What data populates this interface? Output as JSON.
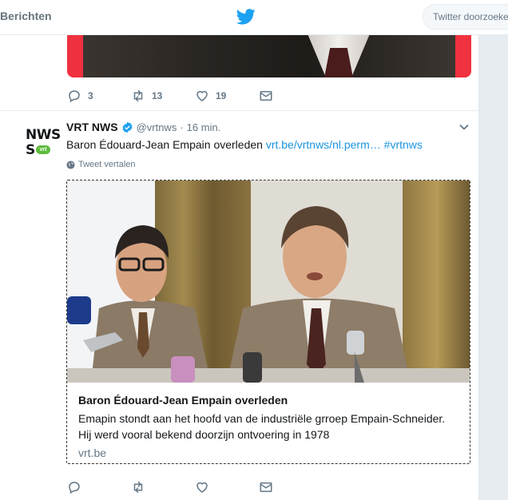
{
  "topbar": {
    "messages_label": "Berichten",
    "logo": "twitter-bird-icon",
    "search_placeholder": "Twitter doorzoeken",
    "brand_color": "#1da1f2"
  },
  "previous_tweet": {
    "reply_count": "3",
    "retweet_count": "13",
    "like_count": "19"
  },
  "tweet": {
    "display_name": "VRT NWS",
    "handle": "@vrtnws",
    "separator": "·",
    "time": "16 min.",
    "text": "Baron Édouard-Jean Empain overleden ",
    "link": "vrt.be/vrtnws/nl.perm…",
    "hashtag": "#vrtnws",
    "translate_label": "Tweet vertalen",
    "avatar": {
      "line1": "NWS",
      "line2": "S",
      "badge": "vrt",
      "badge_color": "#5dbb3d"
    },
    "link_color": "#1b95e0",
    "card": {
      "title": "Baron Édouard-Jean Empain overleden",
      "description_line1": "Emapin stondt aan het hoofd van de industriële grroep Empain-Schneider.",
      "description_line2": "Hij werd vooral bekend doorzijn ontvoering in 1978",
      "domain": "vrt.be"
    }
  },
  "icons": {
    "reply": "reply-icon",
    "retweet": "retweet-icon",
    "like": "heart-icon",
    "dm": "envelope-icon",
    "globe": "globe-icon",
    "caret": "chevron-down-icon",
    "verified": "verified-badge-icon"
  }
}
